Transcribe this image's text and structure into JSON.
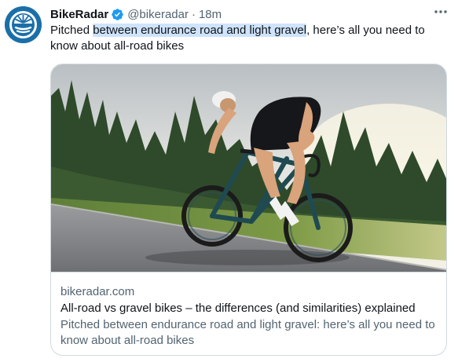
{
  "tweet": {
    "author_name": "BikeRadar",
    "author_handle": "@bikeradar",
    "separator": "·",
    "timestamp": "18m",
    "text_before": "Pitched ",
    "text_highlight": "between endurance road and light gravel",
    "text_after": ", here’s all you need to know about all-road bikes",
    "icons": {
      "avatar": "bikeradar-logo-icon",
      "verified": "verified-badge-icon",
      "more": "more-options-icon"
    },
    "colors": {
      "verified": "#1d9bf0",
      "secondary_text": "#536471",
      "highlight": "#cfe3fb",
      "brand": "#1b6fa8"
    }
  },
  "card": {
    "image_description_icon": "cyclist-photo",
    "domain": "bikeradar.com",
    "title": "All-road vs gravel bikes – the differences (and similarities) explained",
    "description": "Pitched between endurance road and light gravel: here’s all you need to know about all-road bikes"
  }
}
